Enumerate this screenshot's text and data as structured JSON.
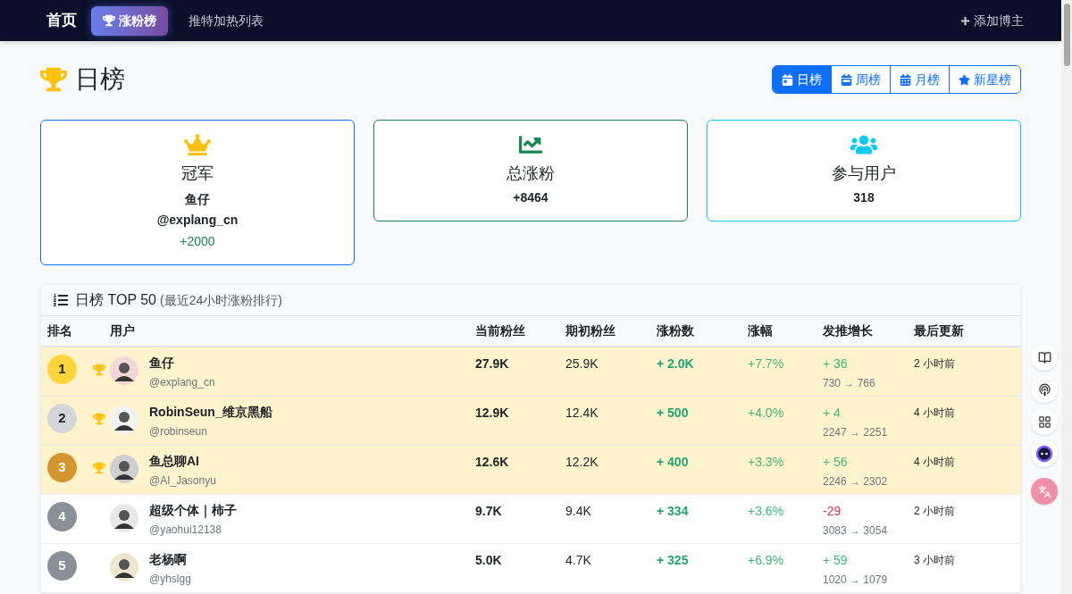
{
  "nav": {
    "brand": "首页",
    "items": [
      {
        "label": "涨粉榜",
        "selected": true
      },
      {
        "label": "推特加热列表",
        "selected": false
      }
    ],
    "add_button": "添加博主"
  },
  "page_title": "日榜",
  "range_tabs": [
    {
      "label": "日榜",
      "kind": "day",
      "selected": true
    },
    {
      "label": "周榜",
      "kind": "week",
      "selected": false
    },
    {
      "label": "月榜",
      "kind": "month",
      "selected": false
    },
    {
      "label": "新星榜",
      "kind": "star",
      "selected": false
    }
  ],
  "stats": [
    {
      "kind": "champion",
      "color": "#0d6efd",
      "title": "冠军",
      "name": "鱼仔",
      "handle": "@explang_cn",
      "value": "+2000"
    },
    {
      "kind": "growth",
      "color": "#198754",
      "title": "总涨粉",
      "value": "+8464"
    },
    {
      "kind": "users",
      "color": "#0dcaf0",
      "title": "参与用户",
      "value": "318"
    }
  ],
  "table": {
    "title": "日榜 TOP 50",
    "subtitle": "(最近24小时涨粉排行)",
    "columns": [
      "排名",
      "用户",
      "当前粉丝",
      "期初粉丝",
      "涨粉数",
      "涨幅",
      "发推增长",
      "最后更新"
    ],
    "rows": [
      {
        "kind": "gold",
        "rank": "1",
        "name": "鱼仔",
        "handle": "@explang_cn",
        "current": "27.9K",
        "initial": "25.9K",
        "gain": "+ 2.0K",
        "pct": "+7.7%",
        "tweets": "+ 36",
        "negative": false,
        "tweet_range": "730 → 766",
        "updated": "2 小时前"
      },
      {
        "kind": "silver",
        "rank": "2",
        "name": "RobinSeun_维京黑船",
        "handle": "@robinseun",
        "current": "12.9K",
        "initial": "12.4K",
        "gain": "+ 500",
        "pct": "+4.0%",
        "tweets": "+ 4",
        "negative": false,
        "tweet_range": "2247 → 2251",
        "updated": "4 小时前"
      },
      {
        "kind": "bronze",
        "rank": "3",
        "name": "鱼总聊AI",
        "handle": "@AI_Jasonyu",
        "current": "12.6K",
        "initial": "12.2K",
        "gain": "+ 400",
        "pct": "+3.3%",
        "tweets": "+ 56",
        "negative": false,
        "tweet_range": "2246 → 2302",
        "updated": "4 小时前"
      },
      {
        "kind": "plain",
        "rank": "4",
        "name": "超级个体｜柿子",
        "handle": "@yaohui12138",
        "current": "9.7K",
        "initial": "9.4K",
        "gain": "+ 334",
        "pct": "+3.6%",
        "tweets": "-29",
        "negative": true,
        "tweet_range": "3083 → 3054",
        "updated": "2 小时前"
      },
      {
        "kind": "plain",
        "rank": "5",
        "name": "老杨啊",
        "handle": "@yhslgg",
        "current": "5.0K",
        "initial": "4.7K",
        "gain": "+ 325",
        "pct": "+6.9%",
        "tweets": "+ 59",
        "negative": false,
        "tweet_range": "1020 → 1079",
        "updated": "3 小时前"
      }
    ]
  }
}
